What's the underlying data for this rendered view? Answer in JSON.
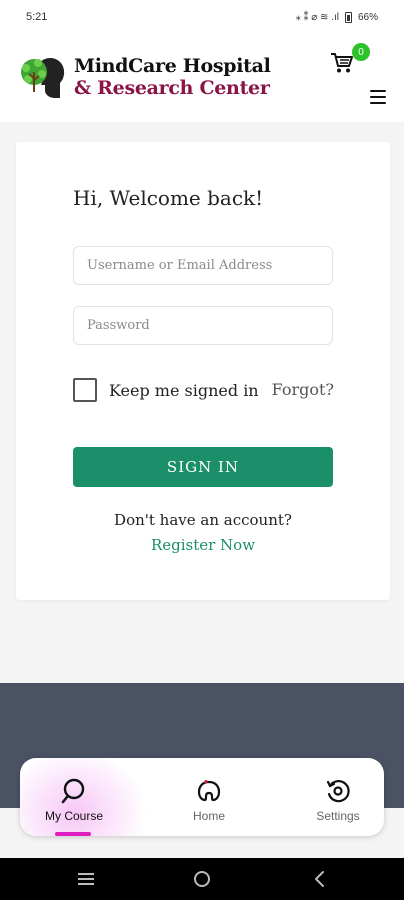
{
  "status_bar": {
    "time": "5:21",
    "indicators": "⁎ ⁑ ⌀ ≋ .ıl",
    "battery": "66%"
  },
  "header": {
    "logo_line1": "MindCare Hospital",
    "logo_line2": "& Research Center",
    "cart_count": "0",
    "colors": {
      "logo_line2": "#8a1446",
      "badge": "#2ec22a"
    },
    "icons": [
      "tree-head-logo-icon",
      "cart-icon",
      "hamburger-menu-icon"
    ]
  },
  "login": {
    "welcome": "Hi, Welcome back!",
    "username_placeholder": "Username or Email Address",
    "password_placeholder": "Password",
    "remember_label": "Keep me signed in",
    "forgot_label": "Forgot?",
    "signin_label": "SIGN IN",
    "no_account": "Don't have an account?",
    "register_label": "Register Now",
    "colors": {
      "primary": "#1b8f69"
    }
  },
  "bottom_nav": {
    "items": [
      {
        "label": "My Course",
        "icon": "search-icon",
        "active": true
      },
      {
        "label": "Home",
        "icon": "home-icon",
        "active": false
      },
      {
        "label": "Settings",
        "icon": "settings-icon",
        "active": false
      }
    ],
    "colors": {
      "active_indicator": "#e01ec0"
    }
  },
  "system_nav": {
    "icons": [
      "recents-icon",
      "home-circle-icon",
      "back-icon"
    ]
  }
}
